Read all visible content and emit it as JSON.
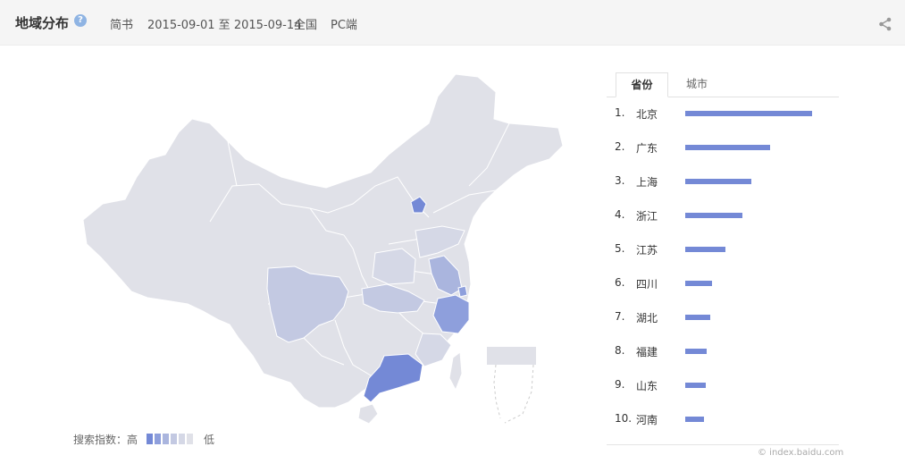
{
  "header": {
    "title": "地域分布",
    "help_icon": "?",
    "keyword": "简书",
    "date_range": "2015-09-01 至 2015-09-14",
    "region": "全国",
    "platform": "PC端"
  },
  "legend": {
    "high_label": "搜索指数：高",
    "low_label": "低"
  },
  "tabs": [
    {
      "label": "省份",
      "active": true
    },
    {
      "label": "城市",
      "active": false
    }
  ],
  "ranking": [
    {
      "rank": "1.",
      "name": "北京",
      "value": 1.0
    },
    {
      "rank": "2.",
      "name": "广东",
      "value": 0.67
    },
    {
      "rank": "3.",
      "name": "上海",
      "value": 0.52
    },
    {
      "rank": "4.",
      "name": "浙江",
      "value": 0.45
    },
    {
      "rank": "5.",
      "name": "江苏",
      "value": 0.32
    },
    {
      "rank": "6.",
      "name": "四川",
      "value": 0.21
    },
    {
      "rank": "7.",
      "name": "湖北",
      "value": 0.2
    },
    {
      "rank": "8.",
      "name": "福建",
      "value": 0.17
    },
    {
      "rank": "9.",
      "name": "山东",
      "value": 0.16
    },
    {
      "rank": "10.",
      "name": "河南",
      "value": 0.15
    }
  ],
  "source": "© index.baidu.com",
  "colors": {
    "level1": "#7489d6",
    "level2": "#8e9fdc",
    "level3": "#aab5de",
    "level4": "#c3c9e2",
    "level5": "#d5d8e6",
    "base": "#e0e1e8",
    "bar": "#7489d6"
  }
}
